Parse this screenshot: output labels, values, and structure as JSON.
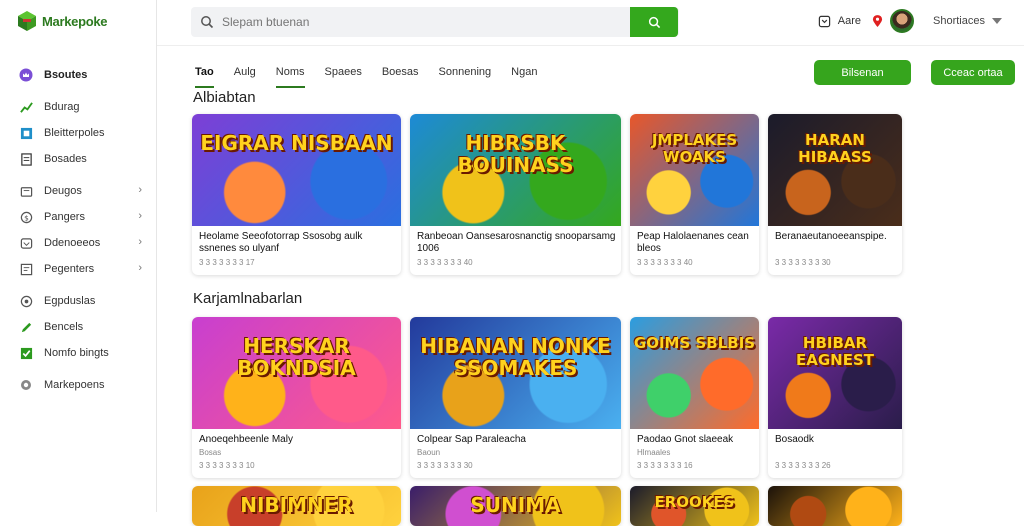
{
  "brand": {
    "name": "Markepoke",
    "green": "#34a81d"
  },
  "sidebar": {
    "items": [
      {
        "label": "Bsoutes",
        "icon": "crown-icon",
        "chev": false,
        "active": true
      },
      {
        "label": "Bdurag",
        "icon": "chart-icon",
        "chev": false
      },
      {
        "label": "Bleitterpoles",
        "icon": "grid-icon",
        "chev": false
      },
      {
        "label": "Bosades",
        "icon": "document-icon",
        "chev": false
      },
      {
        "label": "Deugos",
        "icon": "folder-icon",
        "chev": true
      },
      {
        "label": "Pangers",
        "icon": "coin-icon",
        "chev": true
      },
      {
        "label": "Ddenoeeos",
        "icon": "box-icon",
        "chev": true
      },
      {
        "label": "Pegenters",
        "icon": "tag-icon",
        "chev": true
      },
      {
        "label": "Egpduslas",
        "icon": "settings-icon",
        "chev": false
      },
      {
        "label": "Bencels",
        "icon": "pencil-icon",
        "chev": false
      },
      {
        "label": "Nomfo bingts",
        "icon": "checkbox-icon",
        "chev": false
      },
      {
        "label": "Markepoens",
        "icon": "gear-icon",
        "chev": false
      }
    ]
  },
  "header": {
    "search_placeholder": "Slepam btuenan",
    "bell_label": "Aare",
    "user_label": "Shortiaces"
  },
  "tabs": [
    "Tao",
    "Aulg",
    "Noms",
    "Spaees",
    "Boesas",
    "Sonnening",
    "Ngan"
  ],
  "buttons": {
    "primary": "Bilsenan",
    "secondary": "Cceac ortaa"
  },
  "sections": [
    {
      "title": "Albiabtan",
      "cards": [
        {
          "thumb_text": "EIGRAR NISBAAN",
          "title": "Heolame Seeofotorrap Ssosobg aulk ssnenes so ulyanf",
          "meta": "3 3 3 3 3 3 3 17"
        },
        {
          "thumb_text": "HIBRSBK BOUINASS",
          "title": "Ranbeoan Oansesarosnanctig snooparsamg 1006",
          "meta": "3 3 3 3 3 3 3 40"
        },
        {
          "thumb_text": "JMPLAKES WOAKS",
          "title": "Peap Halolaenanes cean bleos",
          "meta": "3 3 3 3 3 3 3 40"
        },
        {
          "thumb_text": "HARAN HIBAASS",
          "title": "Beranaeutanoeeanspipe.",
          "meta": "3 3 3 3 3 3 3 30"
        }
      ]
    },
    {
      "title": "Karjamlnabarlan",
      "cards": [
        {
          "thumb_text": "HERSKAR BOKNDSIA",
          "title": "Anoeqehbeenle Maly",
          "meta": "3 3 3 3 3 3 3 10",
          "sub": "Bosas"
        },
        {
          "thumb_text": "HIBANAN NONKE SSOMAKES",
          "title": "Colpear Sap Paraleacha",
          "meta": "3 3 3 3 3 3 3 30",
          "sub": "Baoun"
        },
        {
          "thumb_text": "GOIMS SBLBIS",
          "title": "Paodao Gnot slaeeak",
          "meta": "3 3 3 3 3 3 3 16",
          "sub": "Hlmaales"
        },
        {
          "thumb_text": "HBIBAR EAGNEST",
          "title": "Bosaodk",
          "meta": "3 3 3 3 3 3 3 26"
        }
      ]
    },
    {
      "title": "",
      "cards": [
        {
          "thumb_text": "NIBIMNER"
        },
        {
          "thumb_text": "SUNIMA"
        },
        {
          "thumb_text": "EROOKES"
        },
        {
          "thumb_text": ""
        }
      ]
    }
  ]
}
